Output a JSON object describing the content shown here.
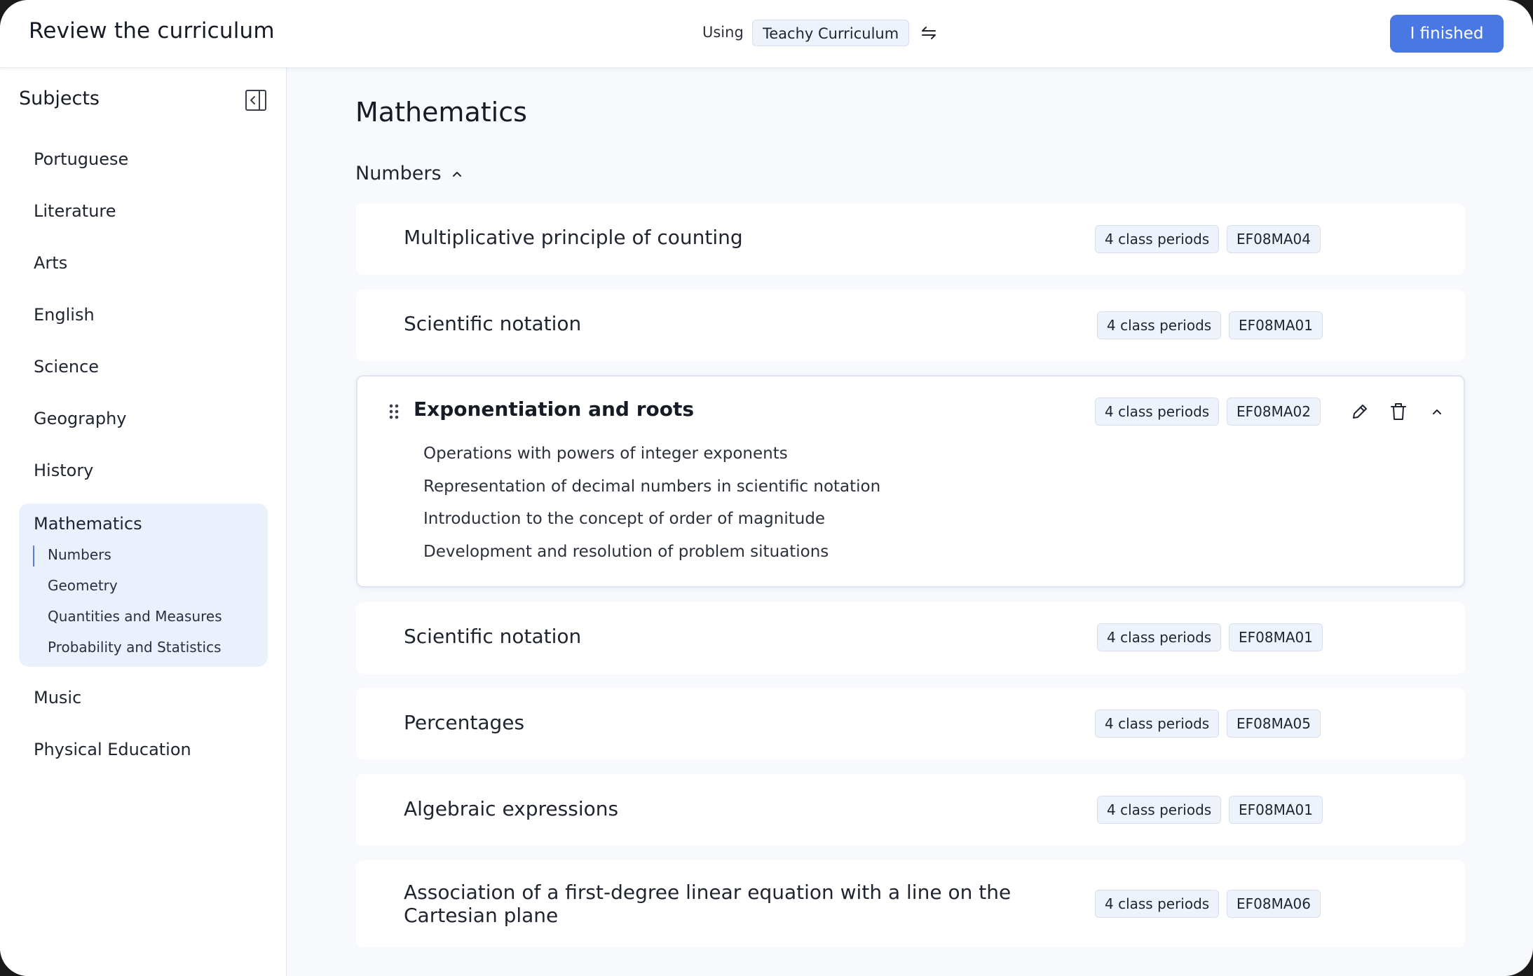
{
  "header": {
    "title": "Review the curriculum",
    "using_label": "Using",
    "curriculum_name": "Teachy Curriculum",
    "swap_icon": "swap-arrows-icon",
    "finished_label": "I finished",
    "accent_color": "#4a78e2"
  },
  "sidebar": {
    "heading": "Subjects",
    "collapse_icon": "sidebar-collapse-icon",
    "items": [
      {
        "label": "Portuguese"
      },
      {
        "label": "Literature"
      },
      {
        "label": "Arts"
      },
      {
        "label": "English"
      },
      {
        "label": "Science"
      },
      {
        "label": "Geography"
      },
      {
        "label": "History"
      },
      {
        "label": "Mathematics",
        "active": true
      },
      {
        "label": "Music"
      },
      {
        "label": "Physical Education"
      }
    ],
    "math_subitems": [
      {
        "label": "Numbers",
        "active": true
      },
      {
        "label": "Geometry"
      },
      {
        "label": "Quantities and Measures"
      },
      {
        "label": "Probability and Statistics"
      }
    ]
  },
  "main": {
    "title": "Mathematics",
    "section": {
      "label": "Numbers",
      "expanded": true
    },
    "cards": [
      {
        "title": "Multiplicative principle of counting",
        "periods": "4 class periods",
        "code": "EF08MA04"
      },
      {
        "title": "Scientific notation",
        "periods": "4 class periods",
        "code": "EF08MA01"
      },
      {
        "title": "Exponentiation and roots",
        "periods": "4 class periods",
        "code": "EF08MA02",
        "expanded": true,
        "skills": [
          "Operations with powers of integer exponents",
          "Representation of decimal numbers in scientific notation",
          "Introduction to the concept of order of magnitude",
          "Development and resolution of problem situations"
        ]
      },
      {
        "title": "Scientific notation",
        "periods": "4 class periods",
        "code": "EF08MA01"
      },
      {
        "title": "Percentages",
        "periods": "4 class periods",
        "code": "EF08MA05"
      },
      {
        "title": "Algebraic expressions",
        "periods": "4 class periods",
        "code": "EF08MA01"
      },
      {
        "title": "Association of a first-degree linear equation with a line on the Cartesian plane",
        "periods": "4 class periods",
        "code": "EF08MA06"
      }
    ]
  }
}
